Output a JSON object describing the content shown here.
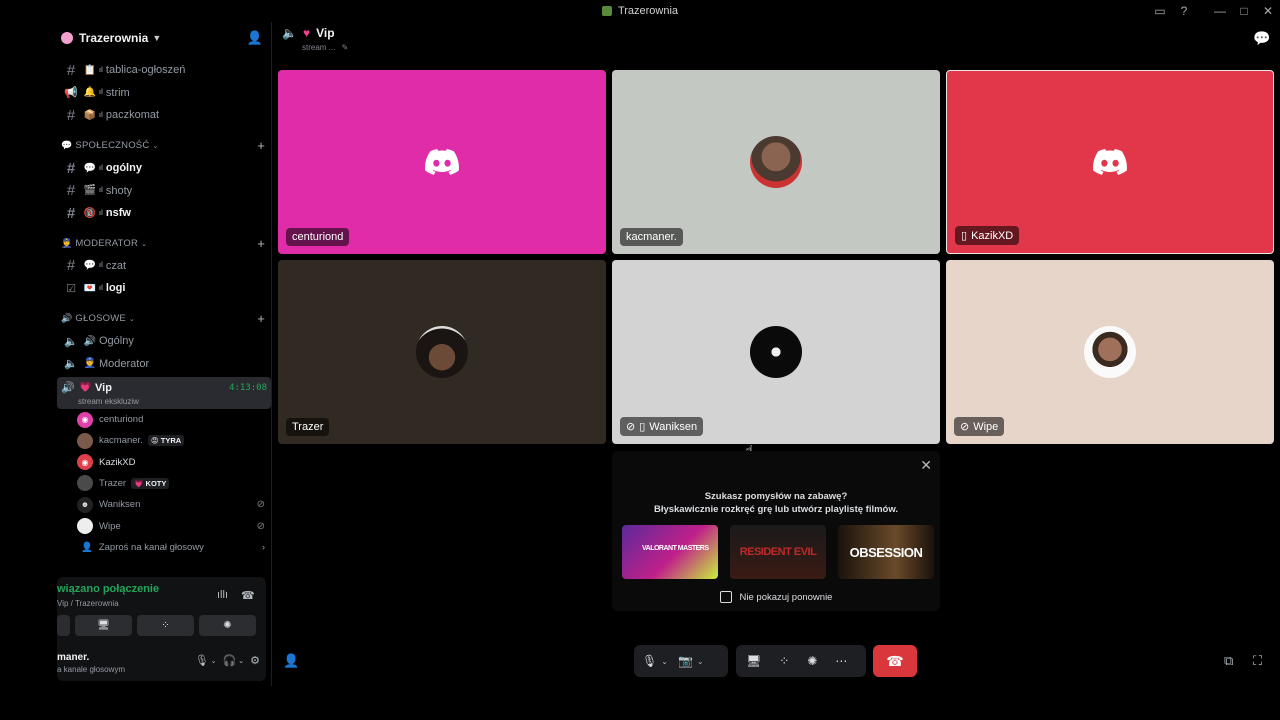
{
  "window": {
    "title": "Trazerownia"
  },
  "server": {
    "name": "Trazerownia"
  },
  "channels_top": [
    {
      "label": "tablica-ogłoszeń",
      "emoji": "📋",
      "type": "text"
    },
    {
      "label": "strim",
      "emoji": "🔔",
      "type": "announce"
    },
    {
      "label": "paczkomat",
      "emoji": "📦",
      "type": "text"
    }
  ],
  "categories": {
    "community": {
      "label": "SPOŁECZNOŚĆ",
      "emoji": "💬"
    },
    "moderator": {
      "label": "MODERATOR",
      "emoji": "👮"
    },
    "voice": {
      "label": "GŁOSOWE",
      "emoji": "🔊"
    }
  },
  "channels_community": [
    {
      "label": "ogólny",
      "emoji": "💬",
      "bright": true
    },
    {
      "label": "shoty",
      "emoji": "🎬",
      "bright": false
    },
    {
      "label": "nsfw",
      "emoji": "🔞",
      "bright": true
    }
  ],
  "channels_moderator": [
    {
      "label": "czat",
      "emoji": "💬",
      "bright": false
    },
    {
      "label": "logi",
      "emoji": "💌",
      "bright": true
    }
  ],
  "voice_channels": [
    {
      "label": "Ogólny",
      "emoji": "🔊"
    },
    {
      "label": "Moderator",
      "emoji": "👮"
    }
  ],
  "active_voice": {
    "label": "Vip",
    "emoji": "💗",
    "timer": "4:13:08",
    "status": "stream ekskluziw"
  },
  "members": [
    {
      "name": "centuriond",
      "tag": "",
      "muted": false,
      "color": "#e040a8"
    },
    {
      "name": "kacmaner.",
      "tag": "TYRA",
      "tag_emoji": "😡",
      "muted": false,
      "color": "#7a5a4a"
    },
    {
      "name": "KazikXD",
      "tag": "",
      "muted": false,
      "color": "#e0404c"
    },
    {
      "name": "Trazer",
      "tag": "KOTY",
      "tag_emoji": "💗",
      "muted": false,
      "color": "#4a4a4a"
    },
    {
      "name": "Waniksen",
      "tag": "",
      "muted": true,
      "color": "#222"
    },
    {
      "name": "Wipe",
      "tag": "",
      "muted": true,
      "color": "#eee"
    }
  ],
  "invite_voice": "Zaproś na kanał głosowy",
  "voice_panel": {
    "status": "wiązano połączenie",
    "location": "Vip / Trazerownia"
  },
  "user": {
    "name": "maner.",
    "status": "a kanale głosowym"
  },
  "header": {
    "channel": "Vip",
    "sub": "stream ..."
  },
  "tiles": [
    {
      "name": "centuriond",
      "bg": "#e12ca9",
      "kind": "discord",
      "icons": ""
    },
    {
      "name": "kacmaner.",
      "bg": "#c4c8c3",
      "kind": "photo",
      "icons": ""
    },
    {
      "name": "KazikXD",
      "bg": "#e2374b",
      "kind": "discord",
      "icons": "📱"
    },
    {
      "name": "Trazer",
      "bg": "#312a23",
      "kind": "photo",
      "icons": ""
    },
    {
      "name": "Waniksen",
      "bg": "#d3d3d3",
      "kind": "photo",
      "icons": "🔇📱"
    },
    {
      "name": "Wipe",
      "bg": "#e8d5c9",
      "kind": "photo",
      "icons": "🔇"
    }
  ],
  "popup": {
    "line1": "Szukasz pomysłów na zabawę?",
    "line2": "Błyskawicznie rozkręć grę lub utwórz playlistę filmów.",
    "cards": [
      "VALORANT MASTERS",
      "RESIDENT EVIL",
      "OBSESSION"
    ],
    "checkbox": "Nie pokazuj ponownie"
  }
}
